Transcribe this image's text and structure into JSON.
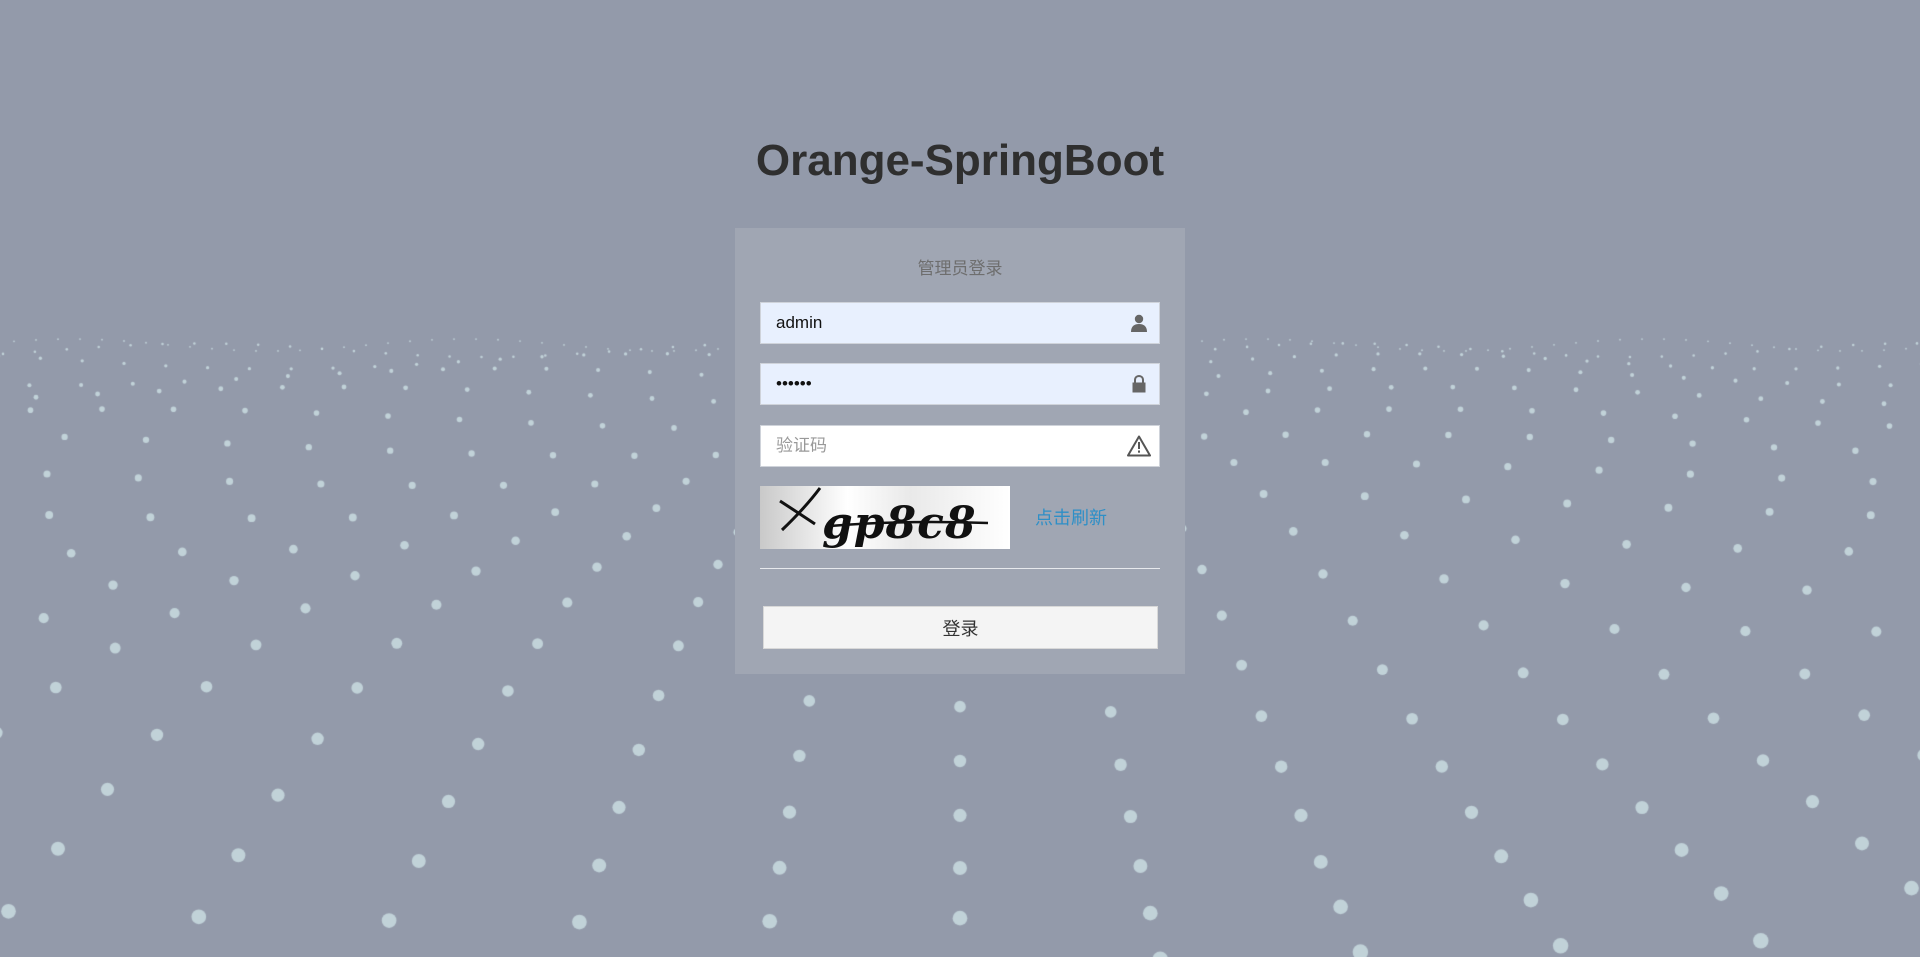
{
  "app_title": "Orange-SpringBoot",
  "login": {
    "title": "管理员登录",
    "username": {
      "value": "admin",
      "icon": "user-icon"
    },
    "password": {
      "value": "••••••",
      "icon": "lock-icon"
    },
    "captcha": {
      "placeholder": "验证码",
      "icon": "warning-icon"
    },
    "captcha_image_text": "gp8c8",
    "refresh_label": "点击刷新",
    "submit_label": "登录"
  },
  "colors": {
    "background": "#939aaa",
    "panel": "#a0a6b3",
    "input_filled": "#e8f0fe",
    "link": "#2e8fc7",
    "dots": "#c9dce0"
  }
}
